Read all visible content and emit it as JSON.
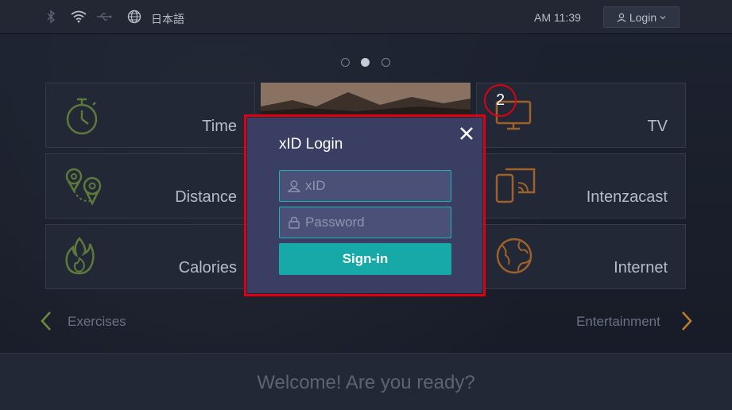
{
  "statusbar": {
    "language": "日本語",
    "time": "AM 11:39",
    "login_label": "Login"
  },
  "pager": {
    "count": 3,
    "active": 2
  },
  "tiles": {
    "time": "Time",
    "distance": "Distance",
    "calories": "Calories",
    "tv": "TV",
    "intenzacast": "Intenzacast",
    "internet": "Internet"
  },
  "nav": {
    "left": "Exercises",
    "right": "Entertainment"
  },
  "welcome": "Welcome! Are you ready?",
  "modal": {
    "title": "xID Login",
    "xid_placeholder": "xID",
    "password_placeholder": "Password",
    "signin_label": "Sign-in"
  },
  "annotation": {
    "badge": "2"
  },
  "colors": {
    "accent_teal": "#17a8a8",
    "fitness_green": "#5d7a3a",
    "entertainment_orange": "#a0602a",
    "highlight_red": "#e00012"
  }
}
